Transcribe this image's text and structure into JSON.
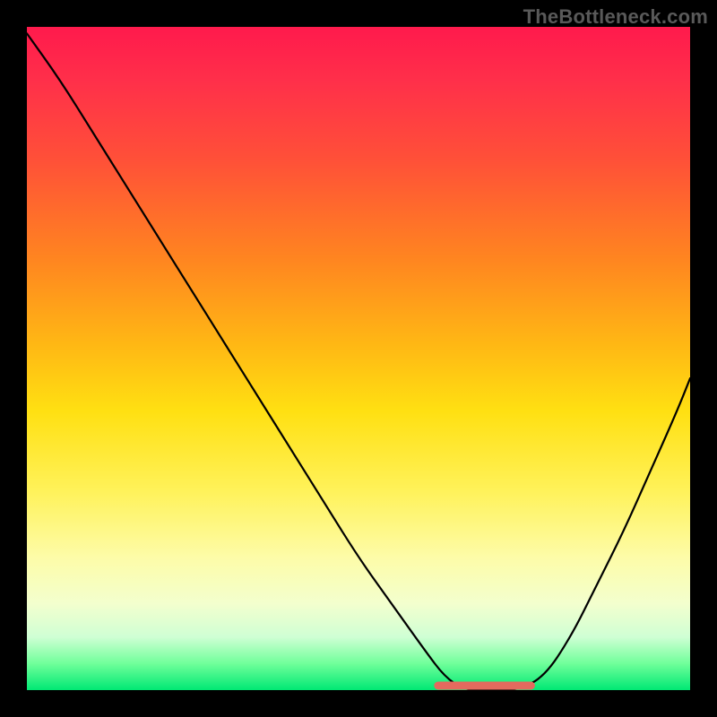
{
  "watermark": "TheBottleneck.com",
  "colors": {
    "gradient_top": "#ff1a4c",
    "gradient_mid1": "#ff8520",
    "gradient_mid2": "#ffe012",
    "gradient_mid3": "#fdfca8",
    "gradient_bottom": "#00e874",
    "frame": "#000000",
    "curve": "#000000",
    "highlight": "#e46a5e"
  },
  "chart_data": {
    "type": "line",
    "title": "",
    "xlabel": "",
    "ylabel": "",
    "xlim": [
      0,
      100
    ],
    "ylim": [
      0,
      100
    ],
    "grid": false,
    "legend": false,
    "series": [
      {
        "name": "bottleneck-curve",
        "x": [
          0,
          5,
          10,
          15,
          20,
          25,
          30,
          35,
          40,
          45,
          50,
          55,
          60,
          63,
          66,
          70,
          74,
          78,
          82,
          86,
          90,
          94,
          98,
          100
        ],
        "values": [
          99,
          92,
          84,
          76,
          68,
          60,
          52,
          44,
          36,
          28,
          20,
          13,
          6,
          2,
          0,
          0,
          0,
          2,
          8,
          16,
          24,
          33,
          42,
          47
        ]
      }
    ],
    "annotations": [
      {
        "name": "flat-bottom-highlight",
        "x_range": [
          62,
          76
        ],
        "y": 0,
        "color": "#e46a5e"
      }
    ]
  }
}
